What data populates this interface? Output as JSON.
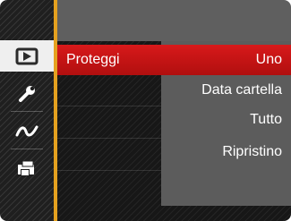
{
  "menu": {
    "selected_item": "Proteggi"
  },
  "submenu": {
    "options": [
      "Uno",
      "Data cartella",
      "Tutto",
      "Ripristino"
    ],
    "selected_index": 0
  },
  "sidebar": {
    "items": [
      {
        "icon": "playback-icon",
        "active": true
      },
      {
        "icon": "wrench-settings-icon",
        "active": false
      },
      {
        "icon": "squiggle-effect-icon",
        "active": false
      },
      {
        "icon": "print-icon",
        "active": false
      }
    ]
  },
  "colors": {
    "accent_red": "#d8191a",
    "divider_orange": "#e5a11f",
    "panel_gray": "#5c5c5c"
  }
}
